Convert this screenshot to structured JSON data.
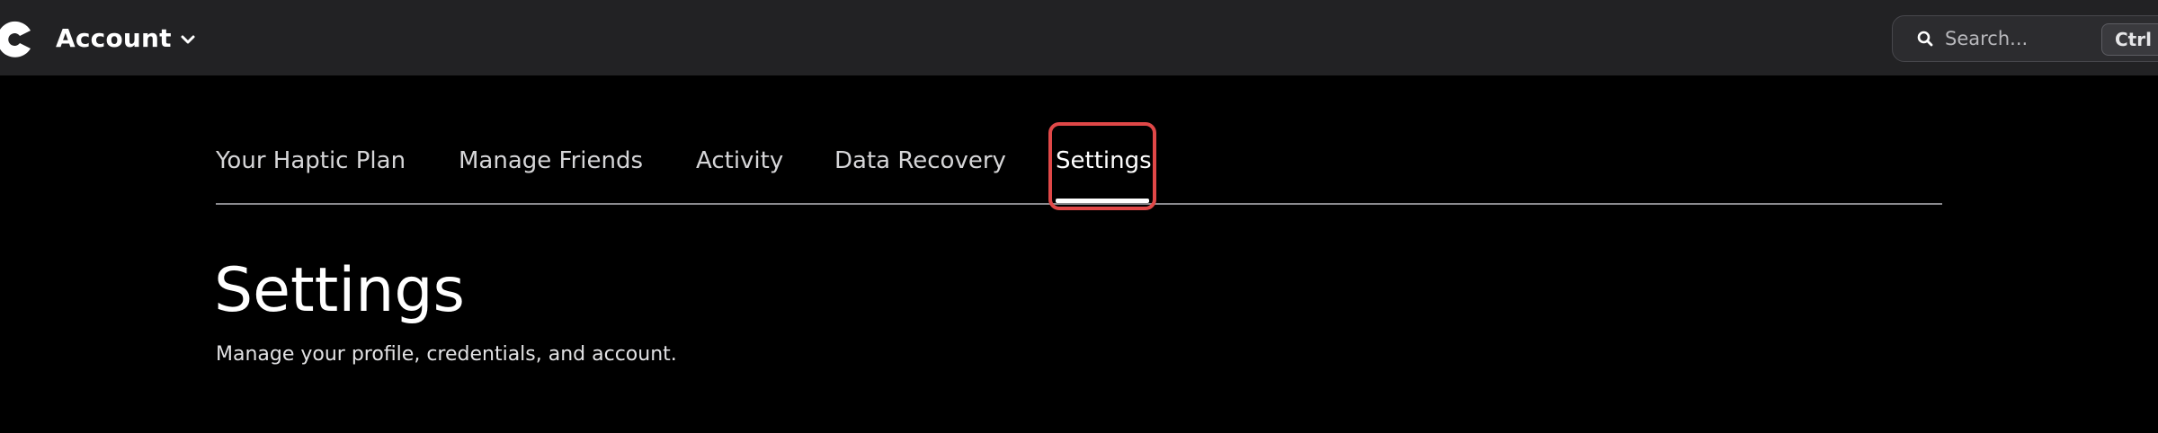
{
  "header": {
    "logo_icon": "brand-c-logo-icon",
    "account_label": "Account",
    "account_chevron_icon": "chevron-down-icon",
    "search": {
      "icon": "search-icon",
      "placeholder": "Search...",
      "shortcut": "Ctrl K"
    }
  },
  "tabs": [
    {
      "label": "Your Haptic Plan",
      "active": false
    },
    {
      "label": "Manage Friends",
      "active": false
    },
    {
      "label": "Activity",
      "active": false
    },
    {
      "label": "Data Recovery",
      "active": false
    },
    {
      "label": "Settings",
      "active": true
    }
  ],
  "main": {
    "title": "Settings",
    "subtitle": "Manage your profile, credentials, and account."
  },
  "colors": {
    "topbar_bg": "#222224",
    "page_bg": "#000000",
    "highlight": "#e04848"
  }
}
